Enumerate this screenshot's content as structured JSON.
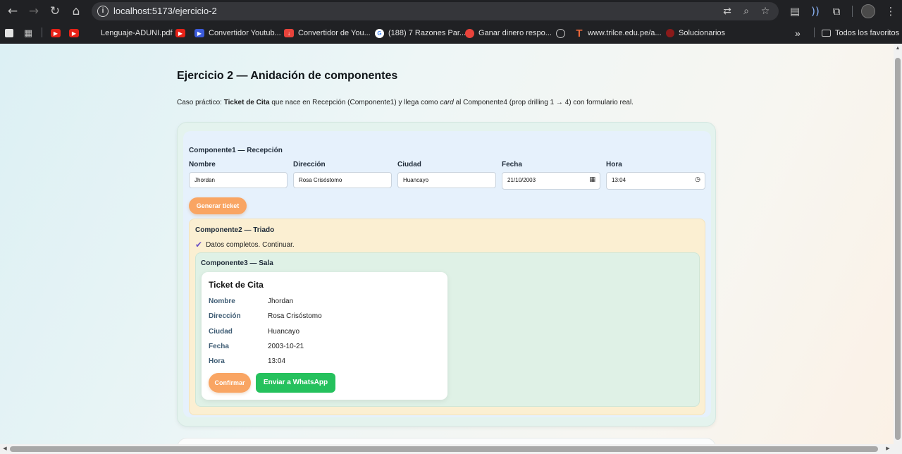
{
  "browser": {
    "url": "localhost:5173/ejercicio-2",
    "bookmarks": [
      {
        "label": "",
        "icon": "youtube-icon"
      },
      {
        "label": "",
        "icon": "youtube-icon"
      },
      {
        "label": "Lenguaje-ADUNI.pdf",
        "icon": "none"
      },
      {
        "label": "",
        "icon": "youtube-icon"
      },
      {
        "label": "Convertidor Youtub...",
        "icon": "converter-icon"
      },
      {
        "label": "Convertidor de You...",
        "icon": "download-icon"
      },
      {
        "label": "(188) 7 Razones Par...",
        "icon": "google-icon"
      },
      {
        "label": "Ganar dinero respo...",
        "icon": "circle-icon"
      },
      {
        "label": "",
        "icon": "globe-icon"
      },
      {
        "label": "www.trilce.edu.pe/a...",
        "icon": "trilce-icon"
      },
      {
        "label": "Solucionarios",
        "icon": "solucionarios-icon"
      }
    ],
    "all_bookmarks": "Todos los favoritos",
    "overflow": "»"
  },
  "page": {
    "title": "Ejercicio 2 — Anidación de componentes",
    "lead_prefix": "Caso práctico:",
    "lead_strong": "Ticket de Cita",
    "lead_mid": "que nace en Recepción (Componente1) y llega como",
    "lead_em": "card",
    "lead_suffix": "al Componente4 (prop drilling 1 → 4) con formulario real."
  },
  "componente1": {
    "title": "Componente1 — Recepción",
    "fields": {
      "nombre": {
        "label": "Nombre",
        "value": "Jhordan"
      },
      "direccion": {
        "label": "Dirección",
        "value": "Rosa Crisóstomo"
      },
      "ciudad": {
        "label": "Ciudad",
        "value": "Huancayo"
      },
      "fecha": {
        "label": "Fecha",
        "value": "21/10/2003"
      },
      "hora": {
        "label": "Hora",
        "value": "13:04"
      }
    },
    "generate_button": "Generar ticket"
  },
  "componente2": {
    "title": "Componente2 — Triado",
    "status": "Datos completos. Continuar."
  },
  "componente3": {
    "title": "Componente3 — Sala"
  },
  "ticket": {
    "title": "Ticket de Cita",
    "rows": [
      {
        "key": "Nombre",
        "value": "Jhordan"
      },
      {
        "key": "Dirección",
        "value": "Rosa Crisóstomo"
      },
      {
        "key": "Ciudad",
        "value": "Huancayo"
      },
      {
        "key": "Fecha",
        "value": "2003-10-21"
      },
      {
        "key": "Hora",
        "value": "13:04"
      }
    ],
    "confirm_button": "Confirmar",
    "whatsapp_button": "Enviar a WhatsApp"
  },
  "colors": {
    "accent_orange": "#f9a563",
    "whatsapp_green": "#25c15d",
    "componente1_bg": "#e6f1fc",
    "componente2_bg": "#fbefd2",
    "componente3_bg": "#dff1e6"
  }
}
